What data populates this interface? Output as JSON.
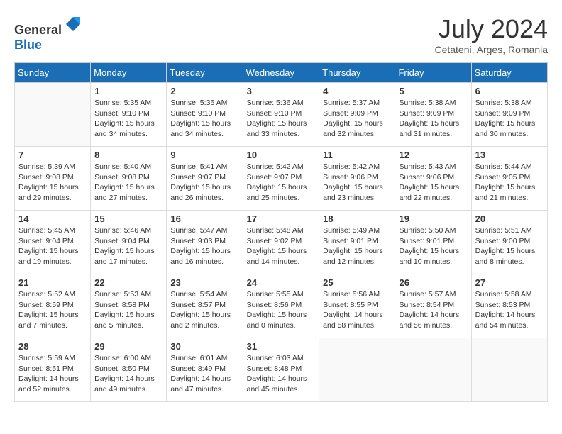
{
  "header": {
    "logo_line1": "General",
    "logo_line2": "Blue",
    "month_year": "July 2024",
    "location": "Cetateni, Arges, Romania"
  },
  "days_of_week": [
    "Sunday",
    "Monday",
    "Tuesday",
    "Wednesday",
    "Thursday",
    "Friday",
    "Saturday"
  ],
  "weeks": [
    [
      {
        "day": "",
        "info": ""
      },
      {
        "day": "1",
        "info": "Sunrise: 5:35 AM\nSunset: 9:10 PM\nDaylight: 15 hours\nand 34 minutes."
      },
      {
        "day": "2",
        "info": "Sunrise: 5:36 AM\nSunset: 9:10 PM\nDaylight: 15 hours\nand 34 minutes."
      },
      {
        "day": "3",
        "info": "Sunrise: 5:36 AM\nSunset: 9:10 PM\nDaylight: 15 hours\nand 33 minutes."
      },
      {
        "day": "4",
        "info": "Sunrise: 5:37 AM\nSunset: 9:09 PM\nDaylight: 15 hours\nand 32 minutes."
      },
      {
        "day": "5",
        "info": "Sunrise: 5:38 AM\nSunset: 9:09 PM\nDaylight: 15 hours\nand 31 minutes."
      },
      {
        "day": "6",
        "info": "Sunrise: 5:38 AM\nSunset: 9:09 PM\nDaylight: 15 hours\nand 30 minutes."
      }
    ],
    [
      {
        "day": "7",
        "info": "Sunrise: 5:39 AM\nSunset: 9:08 PM\nDaylight: 15 hours\nand 29 minutes."
      },
      {
        "day": "8",
        "info": "Sunrise: 5:40 AM\nSunset: 9:08 PM\nDaylight: 15 hours\nand 27 minutes."
      },
      {
        "day": "9",
        "info": "Sunrise: 5:41 AM\nSunset: 9:07 PM\nDaylight: 15 hours\nand 26 minutes."
      },
      {
        "day": "10",
        "info": "Sunrise: 5:42 AM\nSunset: 9:07 PM\nDaylight: 15 hours\nand 25 minutes."
      },
      {
        "day": "11",
        "info": "Sunrise: 5:42 AM\nSunset: 9:06 PM\nDaylight: 15 hours\nand 23 minutes."
      },
      {
        "day": "12",
        "info": "Sunrise: 5:43 AM\nSunset: 9:06 PM\nDaylight: 15 hours\nand 22 minutes."
      },
      {
        "day": "13",
        "info": "Sunrise: 5:44 AM\nSunset: 9:05 PM\nDaylight: 15 hours\nand 21 minutes."
      }
    ],
    [
      {
        "day": "14",
        "info": "Sunrise: 5:45 AM\nSunset: 9:04 PM\nDaylight: 15 hours\nand 19 minutes."
      },
      {
        "day": "15",
        "info": "Sunrise: 5:46 AM\nSunset: 9:04 PM\nDaylight: 15 hours\nand 17 minutes."
      },
      {
        "day": "16",
        "info": "Sunrise: 5:47 AM\nSunset: 9:03 PM\nDaylight: 15 hours\nand 16 minutes."
      },
      {
        "day": "17",
        "info": "Sunrise: 5:48 AM\nSunset: 9:02 PM\nDaylight: 15 hours\nand 14 minutes."
      },
      {
        "day": "18",
        "info": "Sunrise: 5:49 AM\nSunset: 9:01 PM\nDaylight: 15 hours\nand 12 minutes."
      },
      {
        "day": "19",
        "info": "Sunrise: 5:50 AM\nSunset: 9:01 PM\nDaylight: 15 hours\nand 10 minutes."
      },
      {
        "day": "20",
        "info": "Sunrise: 5:51 AM\nSunset: 9:00 PM\nDaylight: 15 hours\nand 8 minutes."
      }
    ],
    [
      {
        "day": "21",
        "info": "Sunrise: 5:52 AM\nSunset: 8:59 PM\nDaylight: 15 hours\nand 7 minutes."
      },
      {
        "day": "22",
        "info": "Sunrise: 5:53 AM\nSunset: 8:58 PM\nDaylight: 15 hours\nand 5 minutes."
      },
      {
        "day": "23",
        "info": "Sunrise: 5:54 AM\nSunset: 8:57 PM\nDaylight: 15 hours\nand 2 minutes."
      },
      {
        "day": "24",
        "info": "Sunrise: 5:55 AM\nSunset: 8:56 PM\nDaylight: 15 hours\nand 0 minutes."
      },
      {
        "day": "25",
        "info": "Sunrise: 5:56 AM\nSunset: 8:55 PM\nDaylight: 14 hours\nand 58 minutes."
      },
      {
        "day": "26",
        "info": "Sunrise: 5:57 AM\nSunset: 8:54 PM\nDaylight: 14 hours\nand 56 minutes."
      },
      {
        "day": "27",
        "info": "Sunrise: 5:58 AM\nSunset: 8:53 PM\nDaylight: 14 hours\nand 54 minutes."
      }
    ],
    [
      {
        "day": "28",
        "info": "Sunrise: 5:59 AM\nSunset: 8:51 PM\nDaylight: 14 hours\nand 52 minutes."
      },
      {
        "day": "29",
        "info": "Sunrise: 6:00 AM\nSunset: 8:50 PM\nDaylight: 14 hours\nand 49 minutes."
      },
      {
        "day": "30",
        "info": "Sunrise: 6:01 AM\nSunset: 8:49 PM\nDaylight: 14 hours\nand 47 minutes."
      },
      {
        "day": "31",
        "info": "Sunrise: 6:03 AM\nSunset: 8:48 PM\nDaylight: 14 hours\nand 45 minutes."
      },
      {
        "day": "",
        "info": ""
      },
      {
        "day": "",
        "info": ""
      },
      {
        "day": "",
        "info": ""
      }
    ]
  ]
}
